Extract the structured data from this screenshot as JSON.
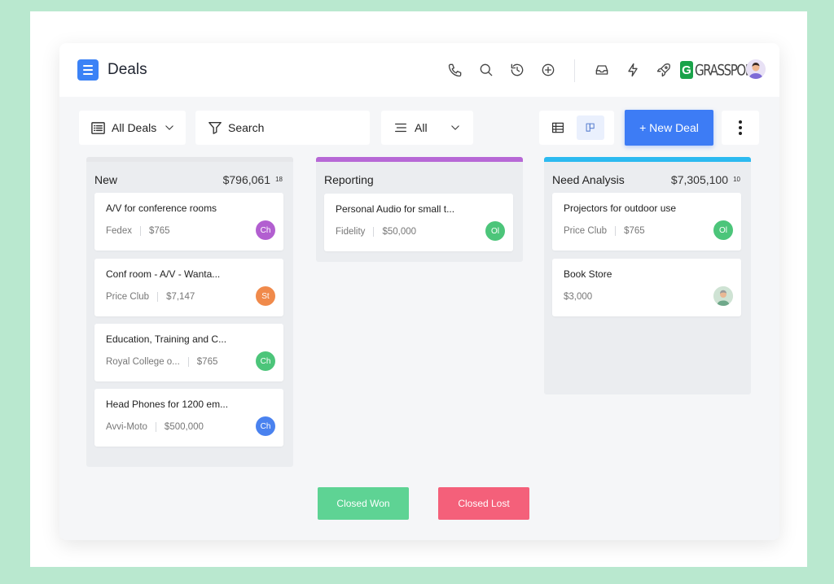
{
  "header": {
    "title": "Deals",
    "icons": [
      "menu-icon",
      "phone-icon",
      "search-icon",
      "history-icon",
      "add-circle-icon",
      "inbox-icon",
      "bolt-icon",
      "rocket-icon"
    ],
    "brand": {
      "mark": "G",
      "text": "GRASSPODS"
    }
  },
  "toolbar": {
    "view_select": "All Deals",
    "search_placeholder": "Search",
    "filter_select": "All",
    "new_deal_label": "+ New Deal"
  },
  "columns": [
    {
      "title": "New",
      "total": "$796,061",
      "count": "18",
      "accent": "#e6e7ea",
      "cards": [
        {
          "title": "A/V for conference rooms",
          "company": "Fedex",
          "amount": "$765",
          "initials": "Ch",
          "avatar_color": "#b25fd0"
        },
        {
          "title": "Conf room - A/V - Wanta...",
          "company": "Price Club",
          "amount": "$7,147",
          "initials": "St",
          "avatar_color": "#f08a4b"
        },
        {
          "title": "Education, Training and C...",
          "company": "Royal College o...",
          "amount": "$765",
          "initials": "Ch",
          "avatar_color": "#4cc57a"
        },
        {
          "title": "Head Phones for 1200 em...",
          "company": "Avvi-Moto",
          "amount": "$500,000",
          "initials": "Ch",
          "avatar_color": "#4a82ef"
        }
      ]
    },
    {
      "title": "Reporting",
      "total": "",
      "count": "",
      "accent": "#b768d6",
      "cards": [
        {
          "title": "Personal Audio for small t...",
          "company": "Fidelity",
          "amount": "$50,000",
          "initials": "Ol",
          "avatar_color": "#4cc57a"
        }
      ]
    },
    {
      "title": "Need Analysis",
      "total": "$7,305,100",
      "count": "10",
      "accent": "#2cbaf0",
      "cards": [
        {
          "title": "Projectors for outdoor use",
          "company": "Price Club",
          "amount": "$765",
          "initials": "Ol",
          "avatar_color": "#4cc57a"
        },
        {
          "title": "Book Store",
          "company": "",
          "amount": "$3,000",
          "initials": "",
          "avatar_color": "#cfe3d4"
        }
      ]
    }
  ],
  "footer": {
    "closed_won": "Closed Won",
    "closed_won_color": "#5ed394",
    "closed_lost": "Closed Lost",
    "closed_lost_color": "#f4607a"
  }
}
